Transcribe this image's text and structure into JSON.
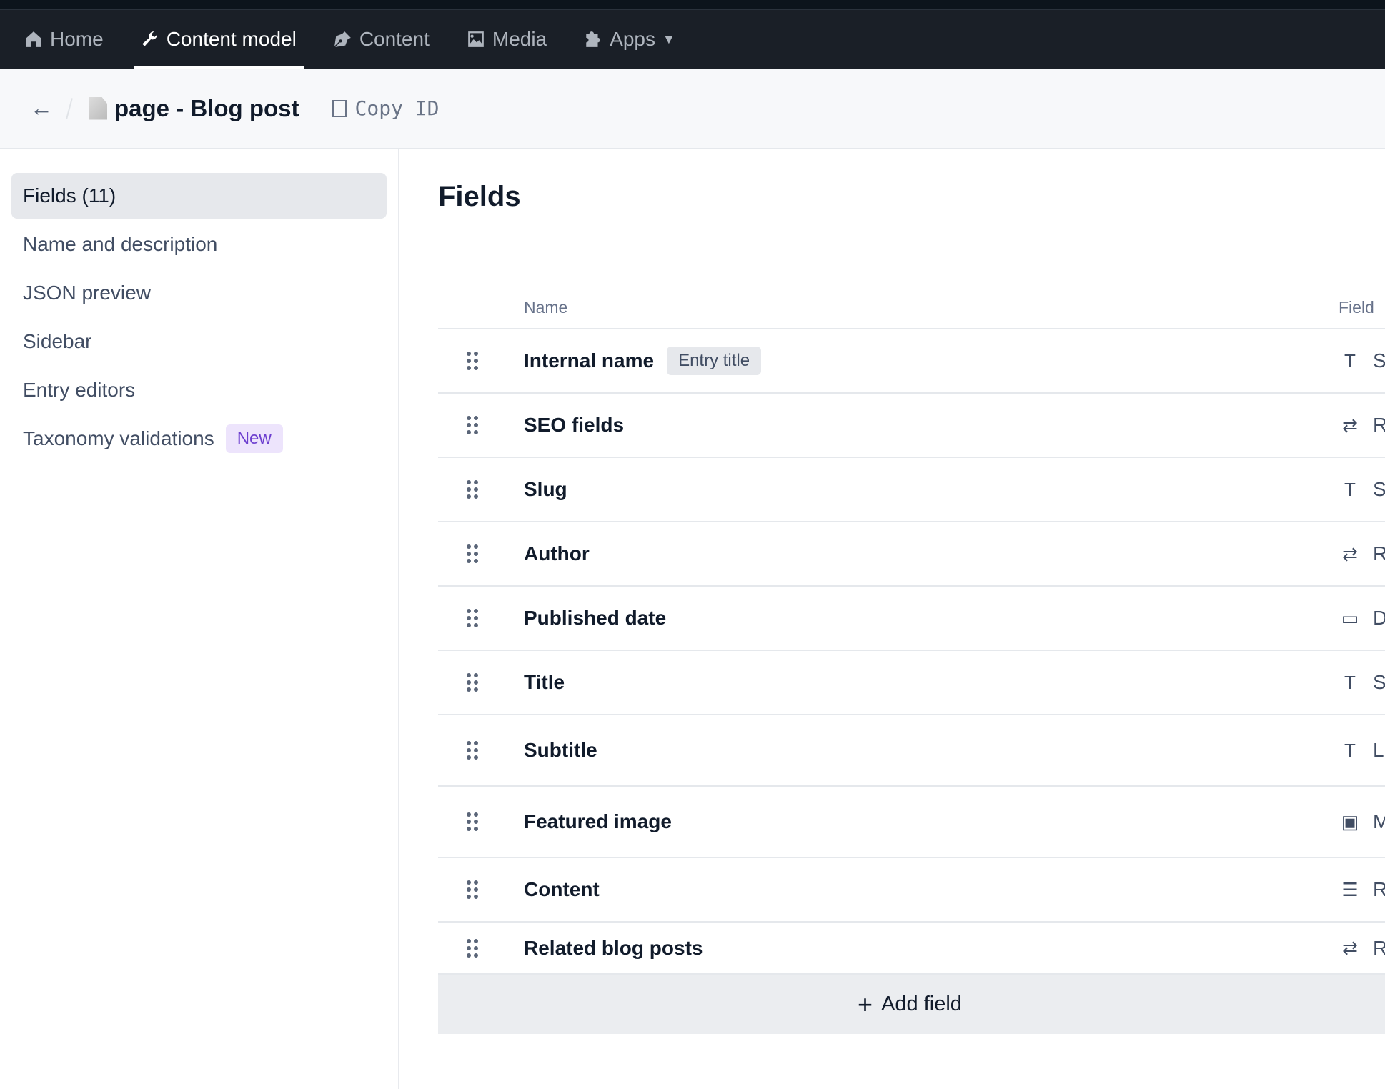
{
  "nav": {
    "items": [
      {
        "label": "Home",
        "icon": "home-icon"
      },
      {
        "label": "Content model",
        "icon": "wrench-icon",
        "active": true
      },
      {
        "label": "Content",
        "icon": "pen-icon"
      },
      {
        "label": "Media",
        "icon": "image-icon"
      },
      {
        "label": "Apps",
        "icon": "puzzle-icon",
        "dropdown": true
      }
    ]
  },
  "header": {
    "title": "page - Blog post",
    "copy_id": "Copy ID"
  },
  "sidebar": {
    "items": [
      {
        "label": "Fields (11)",
        "active": true
      },
      {
        "label": "Name and description"
      },
      {
        "label": "JSON preview"
      },
      {
        "label": "Sidebar"
      },
      {
        "label": "Entry editors"
      },
      {
        "label": "Taxonomy validations",
        "badge": "New"
      }
    ]
  },
  "main": {
    "title": "Fields",
    "columns": {
      "name": "Name",
      "type": "Field"
    },
    "rows": [
      {
        "name": "Internal name",
        "badge": "Entry title",
        "type_icon": "text-icon",
        "type": "S"
      },
      {
        "name": "SEO fields",
        "type_icon": "reference-icon",
        "type": "R"
      },
      {
        "name": "Slug",
        "type_icon": "text-icon",
        "type": "S"
      },
      {
        "name": "Author",
        "type_icon": "reference-icon",
        "type": "R"
      },
      {
        "name": "Published date",
        "type_icon": "calendar-icon",
        "type": "D"
      },
      {
        "name": "Title",
        "type_icon": "text-icon",
        "type": "S"
      },
      {
        "name": "Subtitle",
        "type_icon": "text-icon",
        "type": "L"
      },
      {
        "name": "Featured image",
        "type_icon": "media-icon",
        "type": "M"
      },
      {
        "name": "Content",
        "type_icon": "rich-text-icon",
        "type": "R"
      },
      {
        "name": "Related blog posts",
        "type_icon": "reference-icon",
        "type": "R"
      }
    ],
    "add_field": "Add field"
  }
}
